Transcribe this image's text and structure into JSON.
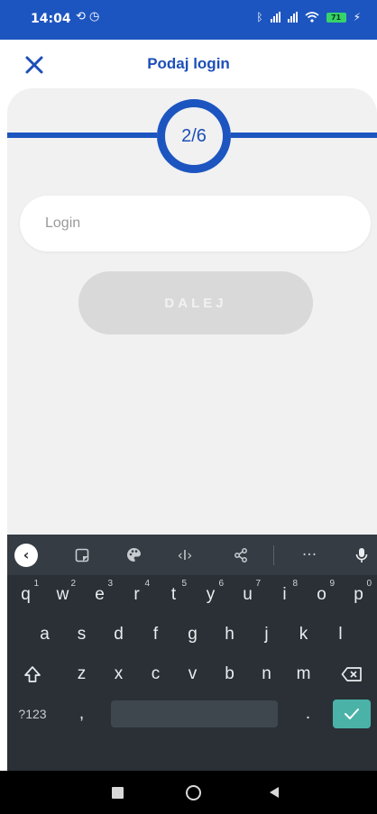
{
  "status_bar": {
    "time": "14:04",
    "left_icons": "⟲ ◷",
    "battery": "71",
    "accent": "#1d55c0"
  },
  "header": {
    "title": "Podaj login",
    "close_icon": "close-icon"
  },
  "progress": {
    "label": "2/6",
    "current_step": 2,
    "total_steps": 6
  },
  "form": {
    "login_placeholder": "Login",
    "login_value": "",
    "next_label": "DALEJ",
    "next_enabled": false
  },
  "keyboard": {
    "toolbar_icons": [
      "back-icon",
      "sticker-icon",
      "palette-icon",
      "cursor-icon",
      "share-icon",
      "more-icon",
      "mic-icon"
    ],
    "rows": {
      "row1": {
        "q": "q",
        "w": "w",
        "e": "e",
        "r": "r",
        "t": "t",
        "y": "y",
        "u": "u",
        "i": "i",
        "o": "o",
        "p": "p",
        "h1": "1",
        "h2": "2",
        "h3": "3",
        "h4": "4",
        "h5": "5",
        "h6": "6",
        "h7": "7",
        "h8": "8",
        "h9": "9",
        "h0": "0"
      },
      "row2": {
        "a": "a",
        "s": "s",
        "d": "d",
        "f": "f",
        "g": "g",
        "h": "h",
        "j": "j",
        "k": "k",
        "l": "l"
      },
      "row3": {
        "z": "z",
        "x": "x",
        "c": "c",
        "v": "v",
        "b": "b",
        "n": "n",
        "m": "m"
      },
      "row4": {
        "symbols": "?123",
        "comma": ",",
        "period": "."
      }
    },
    "enter_color": "#4ab2a7"
  },
  "nav": [
    "recents-icon",
    "home-icon",
    "back-triangle-icon"
  ]
}
